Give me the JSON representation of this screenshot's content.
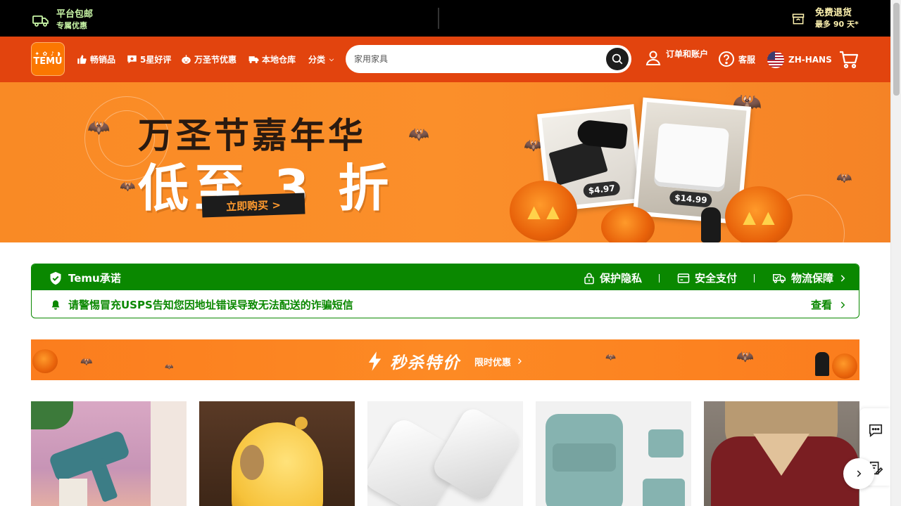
{
  "topbar": {
    "shipping_title": "平台包邮",
    "shipping_sub": "专属优惠",
    "returns_title": "免费退货",
    "returns_sub": "最多 90 天*"
  },
  "header": {
    "logo_text": "TEMU",
    "nav": [
      {
        "label": "畅销品",
        "icon": "thumbs-up-icon"
      },
      {
        "label": "5星好评",
        "icon": "star-review-icon"
      },
      {
        "label": "万圣节优惠",
        "icon": "pumpkin-icon"
      },
      {
        "label": "本地仓库",
        "icon": "truck-icon"
      },
      {
        "label": "分类",
        "icon": "chevron-down-icon"
      }
    ],
    "search_placeholder": "家用家具",
    "account_label": "订单和账户",
    "service_label": "客服",
    "language_label": "ZH-HANS"
  },
  "banner": {
    "title": "万圣节嘉年华",
    "subtitle": "低至 3 折",
    "cta": "立即购买 >",
    "price_1": "$4.97",
    "price_2": "$14.99"
  },
  "promise": {
    "title": "Temu承诺",
    "items": [
      "保护隐私",
      "安全支付",
      "物流保障"
    ],
    "alert": "请警惕冒充USPS告知您因地址错误导致无法配送的诈骗短信",
    "view": "查看"
  },
  "flash": {
    "title": "秒杀特价",
    "subtitle": "限时优惠"
  },
  "products": [
    {
      "icon": "glue-gun-image"
    },
    {
      "icon": "capybara-lamp-image"
    },
    {
      "icon": "usb-c-adapter-image"
    },
    {
      "icon": "backpack-image"
    },
    {
      "icon": "blouse-image"
    }
  ],
  "colors": {
    "header_bg": "#e2440e",
    "brand_orange": "#fb7701",
    "promise_green": "#0a8800",
    "topbar_bg": "#000000"
  }
}
